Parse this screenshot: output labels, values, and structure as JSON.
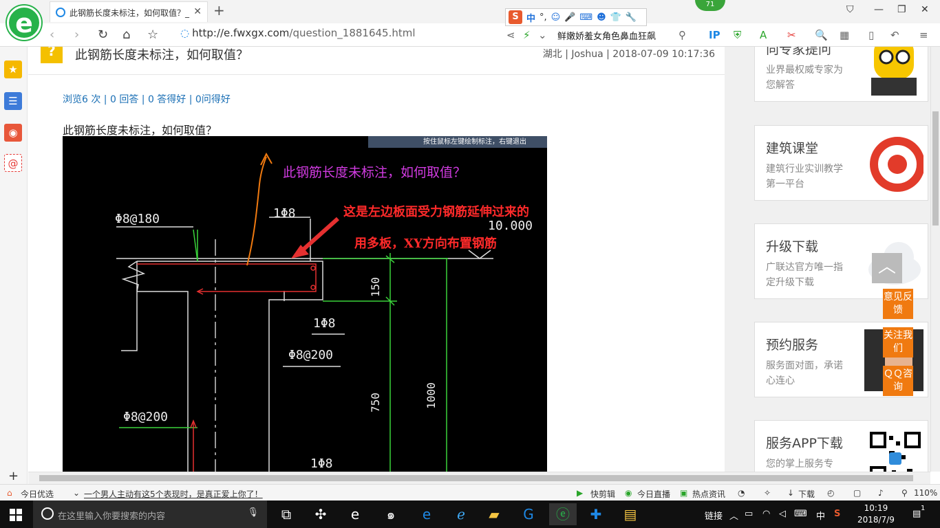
{
  "browser": {
    "tab_title": "此钢筋长度未标注，如何取值？_",
    "url_prefix": "http://e.",
    "url_domain": "fwxgx.com",
    "url_path": "/question_1881645.html",
    "search_text": "鲜嫩娇羞女角色鼻血狂飙",
    "notification_count": "71",
    "ime_mode": "中",
    "ime_punct": "°,"
  },
  "article": {
    "title": "此钢筋长度未标注，如何取值？",
    "meta": "湖北 | Joshua | 2018-07-09 10:17:36",
    "stats": "浏览6 次 | 0 回答 | 0 答得好 | 0问得好",
    "question_body": "此钢筋长度未标注，如何取值？",
    "cad": {
      "hint": "按住鼠标左键绘制标注，右键退出",
      "annotation_question": "此钢筋长度未标注，如何取值？",
      "annotation_line1": "这是左边板面受力钢筋延伸过来的",
      "annotation_line2": "用多板，XY方向布置钢筋",
      "label_phi8_180": "Φ8@180",
      "label_1phi8_top": "1Φ8",
      "label_elev": "10.000",
      "label_150": "150",
      "label_1phi8_mid": "1Φ8",
      "label_phi8_200_mid": "Φ8@200",
      "label_750": "750",
      "label_1000": "1000",
      "label_phi8_200_low": "Φ8@200",
      "label_1phi8_bottom": "1Φ8"
    }
  },
  "sidebar_cards": [
    {
      "title": "向专家提问",
      "desc": "业界最权威专家为您解答"
    },
    {
      "title": "建筑课堂",
      "desc": "建筑行业实训教学第一平台"
    },
    {
      "title": "升级下载",
      "desc": "广联达官方唯一指定升级下载"
    },
    {
      "title": "预约服务",
      "desc": "服务面对面，承诺心连心"
    },
    {
      "title": "服务APP下载",
      "desc": "您的掌上服务专"
    }
  ],
  "float_buttons": {
    "feedback": "意见反馈",
    "follow": "关注我们",
    "qq": "ＱＱ咨询"
  },
  "statusbar": {
    "today": "今日优选",
    "news": "一个男人主动有这5个表现时，是真正爱上你了！",
    "quick_clip": "快剪辑",
    "live": "今日直播",
    "hot": "热点资讯",
    "download": "下载",
    "zoom": "110%"
  },
  "taskbar": {
    "search_placeholder": "在这里输入你要搜索的内容",
    "link_label": "链接",
    "ime": "中",
    "time": "10:19",
    "date": "2018/7/9",
    "notif_count": "1"
  }
}
